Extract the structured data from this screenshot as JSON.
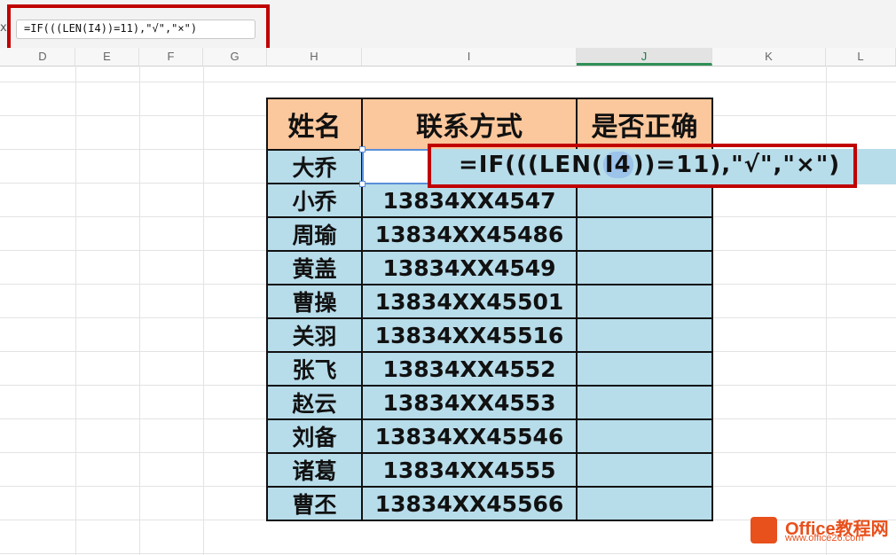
{
  "formula_bar": {
    "fx_label": "x",
    "formula": "=IF(((LEN(I4))=11),\"√\",\"×\")"
  },
  "columns": [
    "D",
    "E",
    "F",
    "G",
    "H",
    "I",
    "J",
    "K",
    "L"
  ],
  "table": {
    "headers": [
      "姓名",
      "联系方式",
      "是否正确"
    ],
    "rows": [
      {
        "name": "大乔",
        "phone": ""
      },
      {
        "name": "小乔",
        "phone": "13834XX4547"
      },
      {
        "name": "周瑜",
        "phone": "13834XX45486"
      },
      {
        "name": "黄盖",
        "phone": "13834XX4549"
      },
      {
        "name": "曹操",
        "phone": "13834XX45501"
      },
      {
        "name": "关羽",
        "phone": "13834XX45516"
      },
      {
        "name": "张飞",
        "phone": "13834XX4552"
      },
      {
        "name": "赵云",
        "phone": "13834XX4553"
      },
      {
        "name": "刘备",
        "phone": "13834XX45546"
      },
      {
        "name": "诸葛",
        "phone": "13834XX4555"
      },
      {
        "name": "曹丕",
        "phone": "13834XX45566"
      }
    ]
  },
  "cell_formula": {
    "pre": "=IF(((LEN(",
    "ref": "I4",
    "post": "))=11),\"√\",\"×\")"
  },
  "watermark": {
    "brand": "Office教程网",
    "url": "www.office26.com"
  },
  "colors": {
    "header_fill": "#fbc79c",
    "body_fill": "#b7dcea",
    "highlight_border": "#c00000",
    "active_column": "#2f8f56"
  }
}
